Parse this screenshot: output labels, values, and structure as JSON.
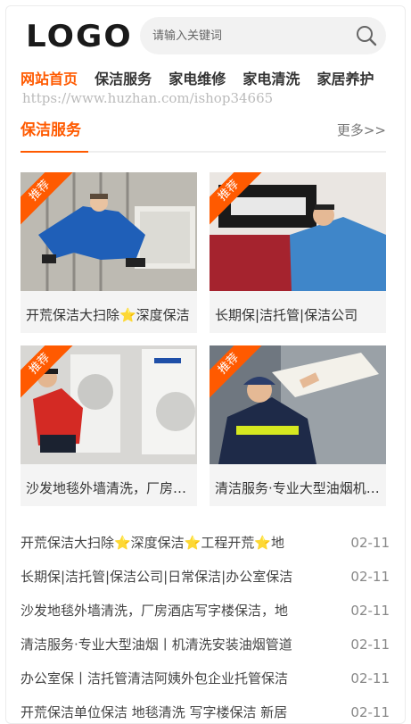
{
  "header": {
    "logo": "LOGO",
    "search": {
      "placeholder": "请输入关键词"
    }
  },
  "nav": [
    {
      "label": "网站首页",
      "active": true
    },
    {
      "label": "保洁服务",
      "active": false
    },
    {
      "label": "家电维修",
      "active": false
    },
    {
      "label": "家电清洗",
      "active": false
    },
    {
      "label": "家居养护",
      "active": false
    }
  ],
  "watermark": "https://www.huzhan.com/ishop34665",
  "section": {
    "title": "保洁服务",
    "more": "更多>>"
  },
  "cards": [
    {
      "badge": "推荐",
      "caption": "开荒保洁大扫除⭐深度保洁"
    },
    {
      "badge": "推荐",
      "caption": "长期保|洁托管|保洁公司"
    },
    {
      "badge": "推荐",
      "caption": "沙发地毯外墙清洗，厂房酒店"
    },
    {
      "badge": "推荐",
      "caption": "清洁服务·专业大型油烟机清洗"
    }
  ],
  "list": [
    {
      "title": "开荒保洁大扫除⭐深度保洁⭐工程开荒⭐地",
      "date": "02-11"
    },
    {
      "title": "长期保|洁托管|保洁公司|日常保洁|办公室保洁",
      "date": "02-11"
    },
    {
      "title": "沙发地毯外墙清洗，厂房酒店写字楼保洁，地",
      "date": "02-11"
    },
    {
      "title": "清洁服务·专业大型油烟丨机清洗安装油烟管道",
      "date": "02-11"
    },
    {
      "title": "办公室保丨洁托管清洁阿姨外包企业托管保洁",
      "date": "02-11"
    },
    {
      "title": "开荒保洁单位保洁 地毯清洗 写字楼保洁 新居",
      "date": "02-11"
    }
  ],
  "colors": {
    "accent": "#ff5a00",
    "icon": "search-icon"
  }
}
